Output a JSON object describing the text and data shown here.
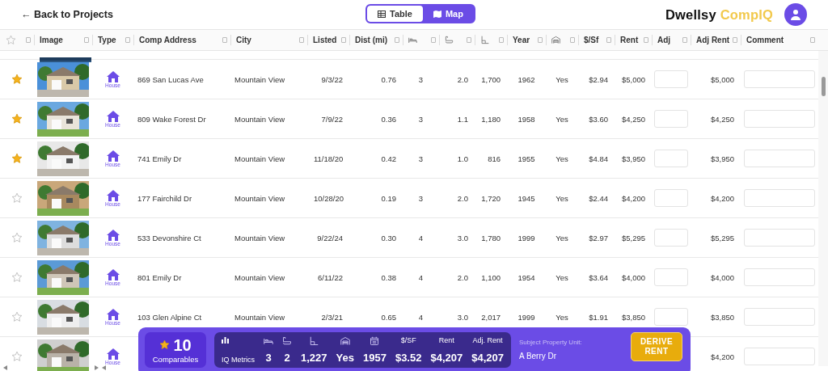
{
  "header": {
    "back_link": "← Back to Projects",
    "view_toggle": [
      {
        "label": "Table",
        "selected": true
      },
      {
        "label": "Map",
        "selected": false
      }
    ],
    "logo": {
      "brand": "Dwellsy",
      "product": "CompIQ"
    }
  },
  "table": {
    "columns": [
      {
        "kind": "star"
      },
      {
        "kind": "text",
        "label": "Image"
      },
      {
        "kind": "text",
        "label": "Type"
      },
      {
        "kind": "text",
        "label": "Comp Address"
      },
      {
        "kind": "text",
        "label": "City"
      },
      {
        "kind": "text",
        "label": "Listed"
      },
      {
        "kind": "text",
        "label": "Dist (mi)"
      },
      {
        "kind": "beds"
      },
      {
        "kind": "baths"
      },
      {
        "kind": "sqft"
      },
      {
        "kind": "text",
        "label": "Year"
      },
      {
        "kind": "garage"
      },
      {
        "kind": "text",
        "label": "$/Sf"
      },
      {
        "kind": "text",
        "label": "Rent"
      },
      {
        "kind": "text",
        "label": "Adj"
      },
      {
        "kind": "text",
        "label": "Adj Rent"
      },
      {
        "kind": "text",
        "label": "Comment"
      }
    ],
    "rows": [
      {
        "starred": true,
        "type": "House",
        "address": "869 San Lucas Ave",
        "city": "Mountain View",
        "listed": "9/3/22",
        "dist": "0.76",
        "beds": "3",
        "baths": "2.0",
        "sqft": "1,700",
        "year": "1962",
        "garage": "Yes",
        "psf": "$2.94",
        "rent": "$5,000",
        "adj_rent": "$5,000"
      },
      {
        "starred": true,
        "type": "House",
        "address": "809 Wake Forest Dr",
        "city": "Mountain View",
        "listed": "7/9/22",
        "dist": "0.36",
        "beds": "3",
        "baths": "1.1",
        "sqft": "1,180",
        "year": "1958",
        "garage": "Yes",
        "psf": "$3.60",
        "rent": "$4,250",
        "adj_rent": "$4,250"
      },
      {
        "starred": true,
        "type": "House",
        "address": "741 Emily Dr",
        "city": "Mountain View",
        "listed": "11/18/20",
        "dist": "0.42",
        "beds": "3",
        "baths": "1.0",
        "sqft": "816",
        "year": "1955",
        "garage": "Yes",
        "psf": "$4.84",
        "rent": "$3,950",
        "adj_rent": "$3,950"
      },
      {
        "starred": false,
        "type": "House",
        "address": "177 Fairchild Dr",
        "city": "Mountain View",
        "listed": "10/28/20",
        "dist": "0.19",
        "beds": "3",
        "baths": "2.0",
        "sqft": "1,720",
        "year": "1945",
        "garage": "Yes",
        "psf": "$2.44",
        "rent": "$4,200",
        "adj_rent": "$4,200"
      },
      {
        "starred": false,
        "type": "House",
        "address": "533 Devonshire Ct",
        "city": "Mountain View",
        "listed": "9/22/24",
        "dist": "0.30",
        "beds": "4",
        "baths": "3.0",
        "sqft": "1,780",
        "year": "1999",
        "garage": "Yes",
        "psf": "$2.97",
        "rent": "$5,295",
        "adj_rent": "$5,295"
      },
      {
        "starred": false,
        "type": "House",
        "address": "801 Emily Dr",
        "city": "Mountain View",
        "listed": "6/11/22",
        "dist": "0.38",
        "beds": "4",
        "baths": "2.0",
        "sqft": "1,100",
        "year": "1954",
        "garage": "Yes",
        "psf": "$3.64",
        "rent": "$4,000",
        "adj_rent": "$4,000"
      },
      {
        "starred": false,
        "type": "House",
        "address": "103 Glen Alpine Ct",
        "city": "Mountain View",
        "listed": "2/3/21",
        "dist": "0.65",
        "beds": "4",
        "baths": "3.0",
        "sqft": "2,017",
        "year": "1999",
        "garage": "Yes",
        "psf": "$1.91",
        "rent": "$3,850",
        "adj_rent": "$3,850"
      },
      {
        "starred": false,
        "type": "House",
        "adj_rent": "$4,200"
      }
    ]
  },
  "summary": {
    "count": "10",
    "count_label": "Comparables",
    "metrics_label": "IQ Metrics",
    "metrics": [
      {
        "kind": "beds",
        "value": "3"
      },
      {
        "kind": "baths",
        "value": "2"
      },
      {
        "kind": "sqft",
        "value": "1,227"
      },
      {
        "kind": "garage",
        "value": "Yes"
      },
      {
        "kind": "year",
        "value": "1957"
      },
      {
        "kind": "text",
        "label": "$/SF",
        "value": "$3.52"
      },
      {
        "kind": "text",
        "label": "Rent",
        "value": "$4,207"
      },
      {
        "kind": "text",
        "label": "Adj. Rent",
        "value": "$4,207"
      }
    ],
    "subject_label": "Subject Property Unit:",
    "subject": "A Berry Dr",
    "button": "DERIVE RENT"
  }
}
